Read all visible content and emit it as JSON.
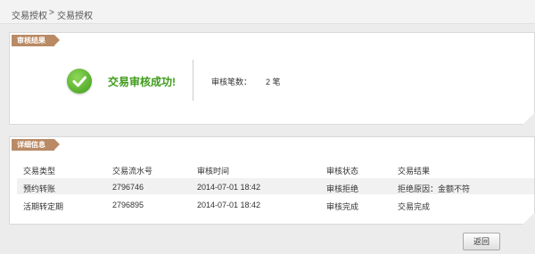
{
  "breadcrumb": {
    "parent": "交易授权",
    "separator": ">",
    "current": "交易授权"
  },
  "result_panel": {
    "ribbon_label": "审核结果",
    "icon": "check-circle-icon",
    "success_message": "交易审核成功!",
    "count_label": "审核笔数：",
    "count_value": "2 笔"
  },
  "detail_panel": {
    "ribbon_label": "详细信息",
    "columns": [
      "交易类型",
      "交易流水号",
      "审核时间",
      "审核状态",
      "交易结果"
    ],
    "rows": [
      [
        "预约转账",
        "2796746",
        "2014-07-01 18:42",
        "审核拒绝",
        "拒绝原因：金额不符"
      ],
      [
        "活期转定期",
        "2796895",
        "2014-07-01 18:42",
        "审核完成",
        "交易完成"
      ]
    ]
  },
  "actions": {
    "back_label": "返回"
  },
  "colors": {
    "ribbon": "#b98a64",
    "success": "#3e9b1a"
  }
}
